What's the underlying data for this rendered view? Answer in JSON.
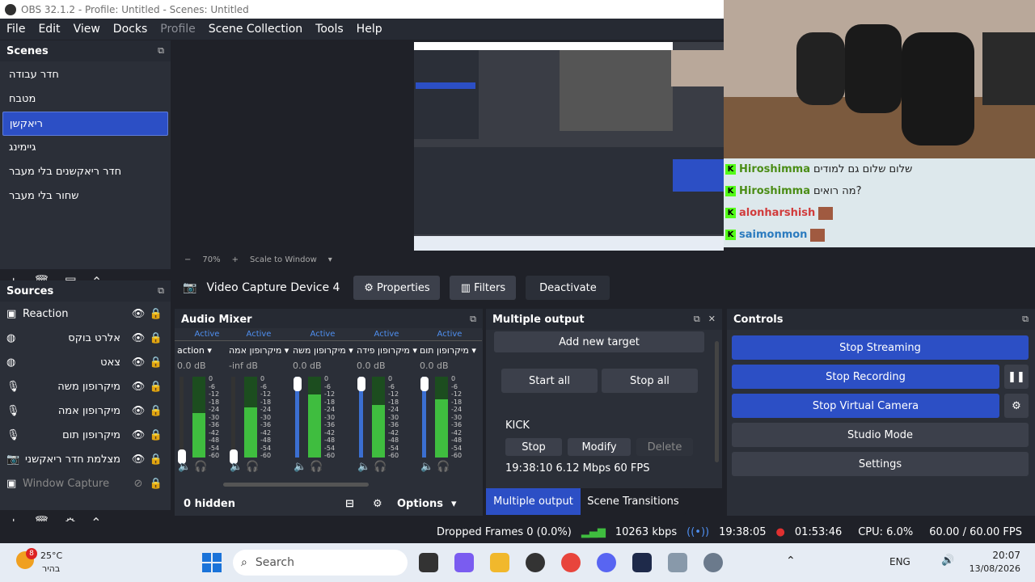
{
  "window": {
    "title": "OBS 32.1.2 - Profile: Untitled - Scenes: Untitled"
  },
  "menu": {
    "items": [
      "File",
      "Edit",
      "View",
      "Docks",
      "Profile",
      "Scene Collection",
      "Tools",
      "Help"
    ]
  },
  "scenes": {
    "title": "Scenes",
    "items": [
      "חדר עבודה",
      "מטבח",
      "ריאקשן",
      "גיימינג",
      "חדר ריאקשנים בלי מעבר",
      "שחור בלי מעבר"
    ],
    "selected": "ריאקשן"
  },
  "sources": {
    "title": "Sources",
    "items": [
      {
        "name": "Reaction",
        "icon": "window-icon"
      },
      {
        "name": "אלרט בוקס",
        "icon": "globe-icon"
      },
      {
        "name": "צאט",
        "icon": "globe-icon"
      },
      {
        "name": "מיקרופון משה",
        "icon": "mic-icon"
      },
      {
        "name": "מיקרופון אמה",
        "icon": "mic-icon"
      },
      {
        "name": "מיקרופון תום",
        "icon": "mic-icon"
      },
      {
        "name": "מצלמת חדר ריאקשני",
        "icon": "camera-icon"
      },
      {
        "name": "Window Capture",
        "icon": "window-icon",
        "hidden": true
      }
    ]
  },
  "preview": {
    "zoom": "70%",
    "scale_mode": "Scale to Window"
  },
  "chat": {
    "lines": [
      {
        "user": "Hiroshimma",
        "text": "שלום שלום גם למודים"
      },
      {
        "user": "Hiroshimma",
        "text": "מה רואים?"
      },
      {
        "user": "alonharshish",
        "text": ""
      },
      {
        "user": "saimonmon",
        "text": ""
      }
    ],
    "user_color": "#4b8d16",
    "alt_user_color": "#d13c3c"
  },
  "source_toolbar": {
    "source": "Video Capture Device 4",
    "properties": "Properties",
    "filters": "Filters",
    "deactivate": "Deactivate"
  },
  "mixer": {
    "title": "Audio Mixer",
    "channels": [
      {
        "status": "Active",
        "name": "action",
        "db": "0.0 dB"
      },
      {
        "status": "Active",
        "name": "מיקרופון אמה",
        "db": "-inf dB"
      },
      {
        "status": "Active",
        "name": "מיקרופון משה",
        "db": "0.0 dB"
      },
      {
        "status": "Active",
        "name": "מיקרופון פידה",
        "db": "0.0 dB"
      },
      {
        "status": "Active",
        "name": "מיקרופון תום",
        "db": "0.0 dB"
      }
    ],
    "scale": [
      "0",
      "-6",
      "-12",
      "-18",
      "-24",
      "-30",
      "-36",
      "-42",
      "-48",
      "-54",
      "-60"
    ],
    "levels": [
      0.55,
      0.62,
      0.78,
      0.65,
      0.72
    ],
    "fader": [
      0.0,
      0.0,
      1.0,
      1.0,
      1.0
    ],
    "hidden_count": "0 hidden",
    "options": "Options"
  },
  "multi": {
    "title": "Multiple output",
    "add_target": "Add new target",
    "start_all": "Start all",
    "stop_all": "Stop all",
    "target_name": "KICK",
    "stop": "Stop",
    "modify": "Modify",
    "delete": "Delete",
    "stats": "19:38:10  6.12 Mbps  60 FPS"
  },
  "tabs": {
    "multiple_output": "Multiple output",
    "scene_transitions": "Scene Transitions"
  },
  "controls": {
    "title": "Controls",
    "stop_streaming": "Stop Streaming",
    "stop_recording": "Stop Recording",
    "stop_virtual_camera": "Stop Virtual Camera",
    "studio_mode": "Studio Mode",
    "settings": "Settings"
  },
  "status": {
    "dropped": "Dropped Frames 0 (0.0%)",
    "bitrate": "10263 kbps",
    "stream_time": "19:38:05",
    "rec_time": "01:53:46",
    "cpu": "CPU: 6.0%",
    "fps": "60.00 / 60.00 FPS"
  },
  "taskbar": {
    "temp": "25°C",
    "weather": "בהיר",
    "badge": "8",
    "search": "Search",
    "lang": "ENG",
    "time": "20:07",
    "date": "13/08/2026"
  },
  "colors": {
    "accent": "#2c4fc5",
    "recording": "#e03030",
    "bitrate": "#3fbd3f"
  }
}
